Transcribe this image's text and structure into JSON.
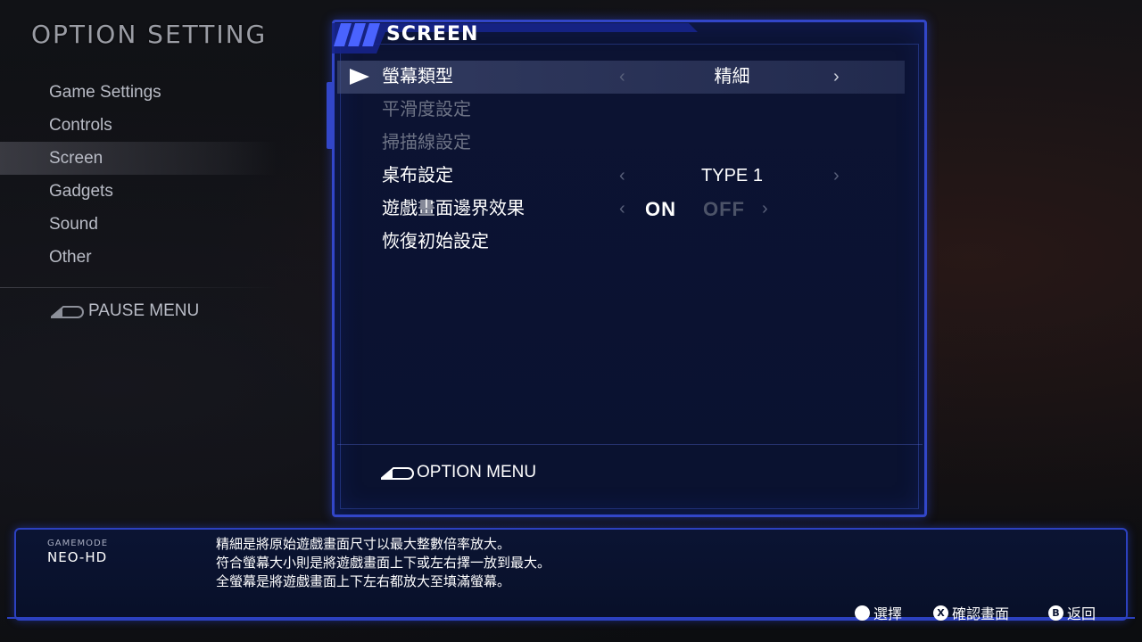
{
  "left_panel": {
    "title": "OPTION SETTING",
    "items": [
      {
        "label": "Game Settings",
        "active": false
      },
      {
        "label": "Controls",
        "active": false
      },
      {
        "label": "Screen",
        "active": true
      },
      {
        "label": "Gadgets",
        "active": false
      },
      {
        "label": "Sound",
        "active": false
      },
      {
        "label": "Other",
        "active": false
      }
    ],
    "pause_menu_label": "PAUSE MENU"
  },
  "panel": {
    "title": "SCREEN",
    "rows": [
      {
        "label": "螢幕類型",
        "value": "精細"
      },
      {
        "label": "平滑度設定"
      },
      {
        "label": "掃描線設定"
      },
      {
        "label": "桌布設定",
        "value": "TYPE 1"
      },
      {
        "label": "遊戲畫面邊界效果",
        "on": "ON",
        "off": "OFF"
      },
      {
        "label": "恢復初始設定"
      }
    ],
    "option_menu_label": "OPTION MENU"
  },
  "help": {
    "gamemode_label": "GAMEMODE",
    "gamemode_name": "NEO-HD",
    "lines": [
      "精細是將原始遊戲畫面尺寸以最大整數倍率放大。",
      "符合螢幕大小則是將遊戲畫面上下或左右擇一放到最大。",
      "全螢幕是將遊戲畫面上下左右都放大至填滿螢幕。"
    ],
    "buttons": [
      {
        "glyph": "",
        "label": "選擇"
      },
      {
        "glyph": "X",
        "label": "確認畫面"
      },
      {
        "glyph": "B",
        "label": "返回"
      }
    ]
  },
  "colors": {
    "panel_border": "#3246c8",
    "panel_bg": "#0c1333",
    "selected_row": "#464f78"
  }
}
